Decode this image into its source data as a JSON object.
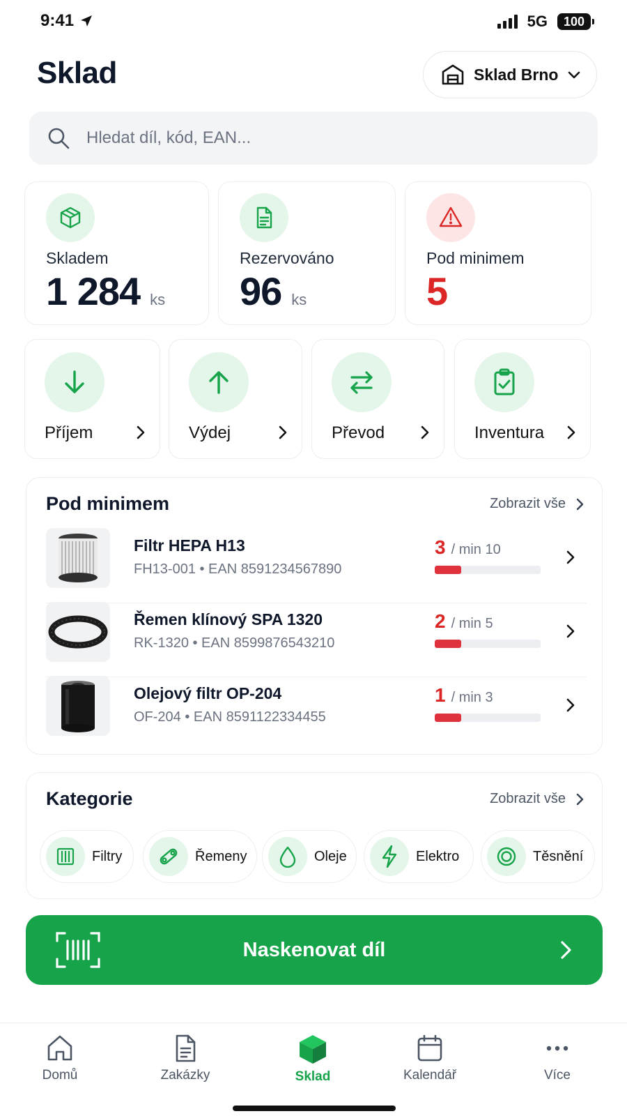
{
  "status_bar": {
    "time": "9:41",
    "network": "5G",
    "battery": "100"
  },
  "header": {
    "title": "Sklad",
    "warehouse": "Sklad Brno"
  },
  "search": {
    "placeholder": "Hledat díl, kód, EAN..."
  },
  "stats": [
    {
      "label": "Skladem",
      "value": "1 284",
      "unit": "ks",
      "icon": "box-icon"
    },
    {
      "label": "Rezervováno",
      "value": "96",
      "unit": "ks",
      "icon": "document-icon"
    },
    {
      "label": "Pod minimem",
      "value": "5",
      "unit": "",
      "icon": "warning-icon"
    }
  ],
  "actions": [
    {
      "label": "Příjem",
      "icon": "arrow-down-icon"
    },
    {
      "label": "Výdej",
      "icon": "arrow-up-icon"
    },
    {
      "label": "Převod",
      "icon": "transfer-icon"
    },
    {
      "label": "Inventura",
      "icon": "clipboard-check-icon"
    }
  ],
  "low_stock": {
    "title": "Pod minimem",
    "link": "Zobrazit vše",
    "items": [
      {
        "name": "Filtr HEPA H13",
        "meta": "FH13-001  •  EAN 8591234567890",
        "qty": "3",
        "min": "/ min 10",
        "fill": 0.25,
        "thumb": "hepa-filter"
      },
      {
        "name": "Řemen klínový SPA 1320",
        "meta": "RK-1320  •  EAN 8599876543210",
        "qty": "2",
        "min": "/ min 5",
        "fill": 0.25,
        "thumb": "v-belt"
      },
      {
        "name": "Olejový filtr OP-204",
        "meta": "OF-204  •  EAN 8591122334455",
        "qty": "1",
        "min": "/ min 3",
        "fill": 0.25,
        "thumb": "oil-filter"
      }
    ]
  },
  "categories": {
    "title": "Kategorie",
    "link": "Zobrazit vše",
    "items": [
      {
        "label": "Filtry",
        "icon": "filter-icon"
      },
      {
        "label": "Řemeny",
        "icon": "belt-icon"
      },
      {
        "label": "Oleje",
        "icon": "oil-drop-icon"
      },
      {
        "label": "Elektro",
        "icon": "lightning-icon"
      },
      {
        "label": "Těsnění",
        "icon": "seal-ring-icon"
      }
    ]
  },
  "scan_button": {
    "label": "Naskenovat díl"
  },
  "tabs": [
    {
      "label": "Domů",
      "icon": "home-icon"
    },
    {
      "label": "Zakázky",
      "icon": "orders-icon"
    },
    {
      "label": "Sklad",
      "icon": "warehouse-cube-icon",
      "active": true
    },
    {
      "label": "Kalendář",
      "icon": "calendar-icon"
    },
    {
      "label": "Více",
      "icon": "more-icon"
    }
  ],
  "colors": {
    "accent": "#16a34a",
    "accent_light": "#e3f6e9",
    "danger": "#dc2626",
    "danger_light": "#fde5e5"
  }
}
